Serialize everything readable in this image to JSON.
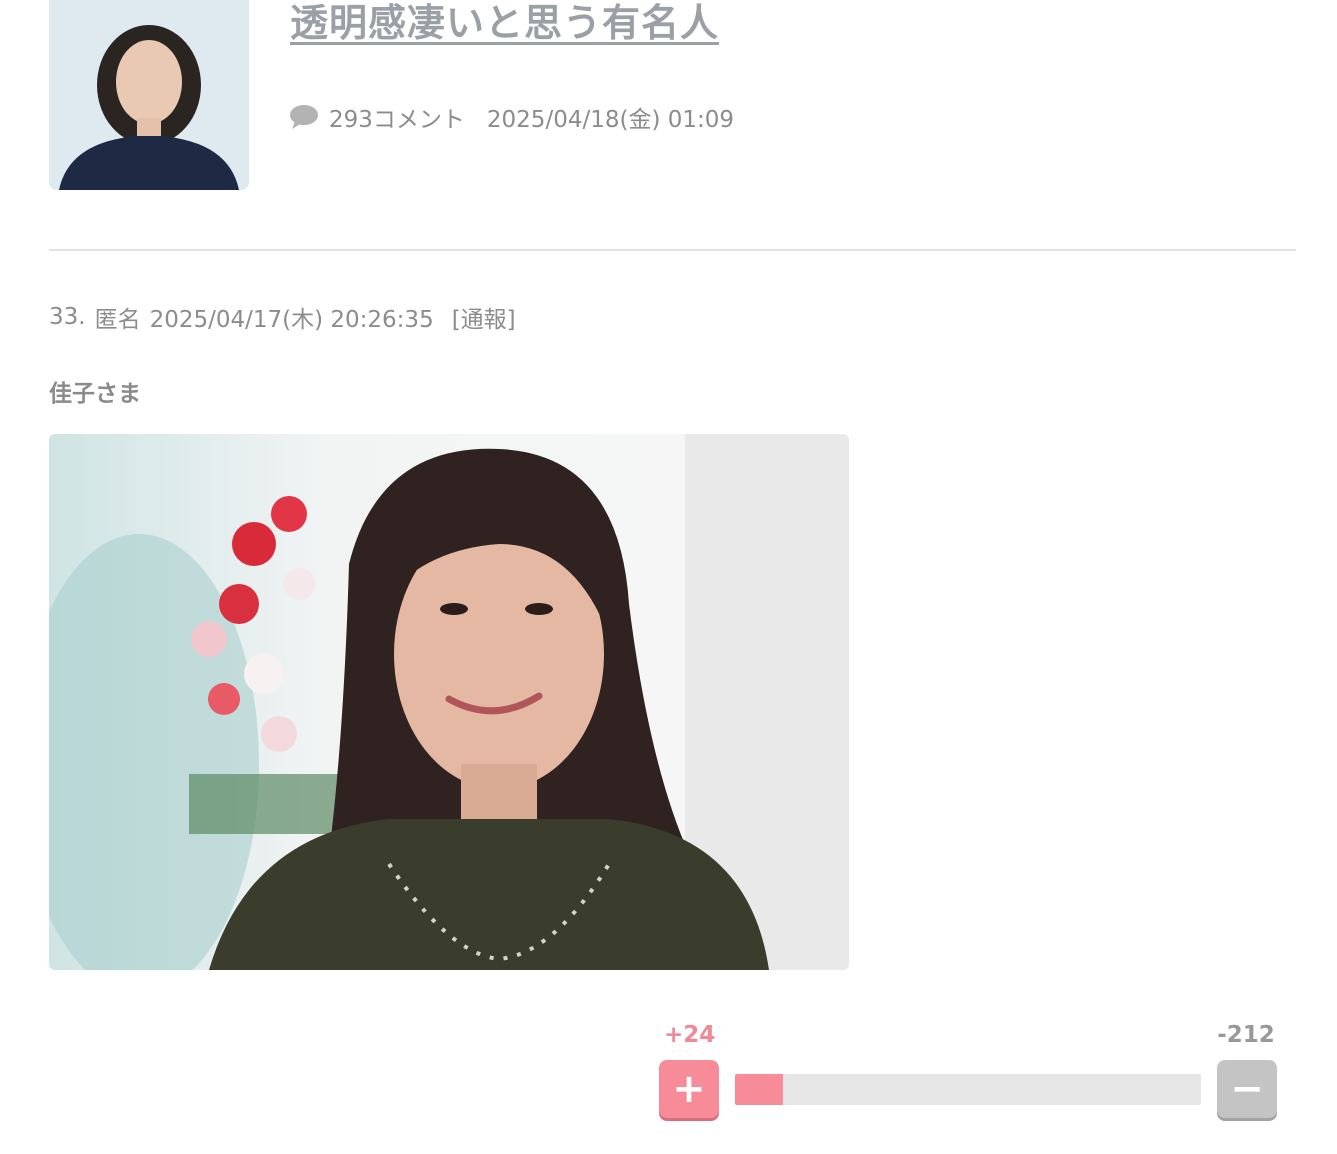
{
  "topic": {
    "title": "透明感凄いと思う有名人",
    "comment_count": "293コメント",
    "date": "2025/04/18(金) 01:09",
    "thumbnail_icon": "avatar-photo"
  },
  "comment": {
    "number": "33.",
    "author": "匿名",
    "datetime": "2025/04/17(木) 20:26:35",
    "report_label": "[通報]",
    "body": "佳子さま",
    "image_icon": "comment-photo"
  },
  "vote": {
    "plus_count": "+24",
    "minus_count": "-212",
    "plus_label": "+",
    "minus_label": "−",
    "plus_fraction": 0.102,
    "plus_color": "#f78b98",
    "minus_color": "#c4c4c4"
  },
  "colors": {
    "title": "#9aa0a6",
    "meta_text": "#8c8c8c",
    "plus_text": "#f08896",
    "divider": "#e3e3e3"
  }
}
